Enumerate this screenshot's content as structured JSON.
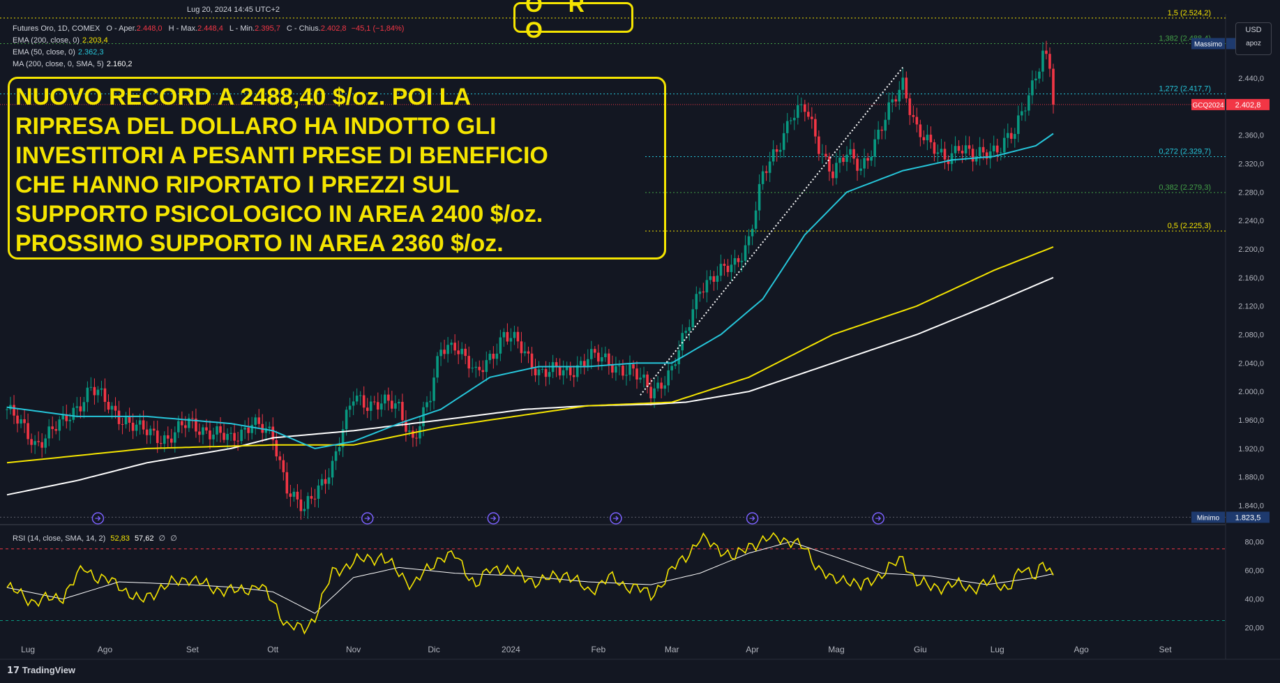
{
  "header": {
    "timestamp": "Lug 20, 2024 14:45 UTC+2",
    "title": "O R O",
    "instrument": "Futures Oro, 1D, COMEX",
    "ohlc": {
      "o_label": "O - Aper.",
      "o": "2.448,0",
      "h_label": "H - Max.",
      "h": "2.448,4",
      "l_label": "L - Min.",
      "l": "2.395,7",
      "c_label": "C - Chius.",
      "c": "2.402,8",
      "chg": "−45,1 (−1,84%)"
    },
    "indicators": [
      {
        "label": "EMA (200, close, 0)",
        "value": "2.203,4",
        "color": "#f5e500"
      },
      {
        "label": "EMA (50, close, 0)",
        "value": "2.362,3",
        "color": "#26c6da"
      },
      {
        "label": "MA (200, close, 0, SMA, 5)",
        "value": "2.160,2",
        "color": "#ffffff"
      }
    ],
    "currency": "USD",
    "currency_sub": "apoz",
    "brand": "TradingView"
  },
  "annotation": {
    "lines": [
      "NUOVO RECORD A 2488,40 $/oz. POI LA",
      "RIPRESA DEL DOLLARO HA INDOTTO GLI",
      "INVESTITORI A PESANTI PRESE DI BENEFICIO",
      "CHE HANNO RIPORTATO I PREZZI SUL",
      "SUPPORTO PSICOLOGICO IN AREA 2400 $/oz.",
      "PROSSIMO SUPPORTO IN AREA 2360 $/oz."
    ]
  },
  "chart_data": [
    {
      "type": "candlestick",
      "ylim": [
        1820,
        2530
      ],
      "y_ticks": [
        1840,
        1880,
        1920,
        1960,
        2000,
        2040,
        2080,
        2120,
        2160,
        2200,
        2240,
        2280,
        2320,
        2360,
        2400,
        2440,
        2480
      ],
      "y_tick_labels": [
        "1.840,0",
        "1.880,0",
        "1.920,0",
        "1.960,0",
        "2.000,0",
        "2.040,0",
        "2.080,0",
        "2.120,0",
        "2.160,0",
        "2.200,0",
        "2.240,0",
        "2.280,0",
        "2.320,0",
        "2.360,0",
        "2.400,0",
        "2.440,0",
        "2.480,0"
      ],
      "x_labels": [
        "Lug",
        "Ago",
        "Set",
        "Ott",
        "Nov",
        "Dic",
        "2024",
        "Feb",
        "Mar",
        "Apr",
        "Mag",
        "Giu",
        "Lug",
        "Ago",
        "Set"
      ],
      "x_label_index": [
        6,
        28,
        53,
        76,
        99,
        122,
        144,
        169,
        190,
        213,
        237,
        261,
        283,
        307,
        331
      ],
      "n_bars": 300,
      "price_path": [
        [
          0,
          1975
        ],
        [
          8,
          1928
        ],
        [
          16,
          1955
        ],
        [
          24,
          2005
        ],
        [
          30,
          1975
        ],
        [
          38,
          1945
        ],
        [
          46,
          1935
        ],
        [
          52,
          1955
        ],
        [
          58,
          1945
        ],
        [
          64,
          1930
        ],
        [
          70,
          1960
        ],
        [
          76,
          1932
        ],
        [
          80,
          1870
        ],
        [
          85,
          1830
        ],
        [
          88,
          1855
        ],
        [
          93,
          1900
        ],
        [
          99,
          1990
        ],
        [
          103,
          1985
        ],
        [
          107,
          1985
        ],
        [
          112,
          1975
        ],
        [
          116,
          1935
        ],
        [
          121,
          1990
        ],
        [
          124,
          2060
        ],
        [
          128,
          2070
        ],
        [
          134,
          2020
        ],
        [
          138,
          2050
        ],
        [
          142,
          2080
        ],
        [
          146,
          2065
        ],
        [
          152,
          2030
        ],
        [
          160,
          2025
        ],
        [
          166,
          2050
        ],
        [
          172,
          2040
        ],
        [
          178,
          2030
        ],
        [
          184,
          2000
        ],
        [
          190,
          2030
        ],
        [
          194,
          2080
        ],
        [
          198,
          2150
        ],
        [
          204,
          2165
        ],
        [
          208,
          2180
        ],
        [
          212,
          2215
        ],
        [
          216,
          2300
        ],
        [
          220,
          2340
        ],
        [
          224,
          2390
        ],
        [
          228,
          2395
        ],
        [
          232,
          2345
        ],
        [
          236,
          2310
        ],
        [
          240,
          2330
        ],
        [
          244,
          2315
        ],
        [
          250,
          2370
        ],
        [
          256,
          2435
        ],
        [
          260,
          2370
        ],
        [
          264,
          2340
        ],
        [
          268,
          2330
        ],
        [
          272,
          2345
        ],
        [
          276,
          2325
        ],
        [
          280,
          2340
        ],
        [
          284,
          2345
        ],
        [
          288,
          2360
        ],
        [
          292,
          2420
        ],
        [
          296,
          2475
        ],
        [
          298,
          2455
        ],
        [
          299,
          2403
        ]
      ],
      "ema200_path": [
        [
          0,
          1900
        ],
        [
          40,
          1920
        ],
        [
          76,
          1925
        ],
        [
          99,
          1925
        ],
        [
          124,
          1950
        ],
        [
          166,
          1980
        ],
        [
          190,
          1985
        ],
        [
          212,
          2020
        ],
        [
          236,
          2080
        ],
        [
          260,
          2120
        ],
        [
          282,
          2170
        ],
        [
          299,
          2203
        ]
      ],
      "ema50_path": [
        [
          0,
          1978
        ],
        [
          20,
          1965
        ],
        [
          40,
          1965
        ],
        [
          64,
          1955
        ],
        [
          76,
          1945
        ],
        [
          88,
          1920
        ],
        [
          99,
          1930
        ],
        [
          112,
          1955
        ],
        [
          124,
          1975
        ],
        [
          138,
          2020
        ],
        [
          152,
          2035
        ],
        [
          166,
          2035
        ],
        [
          180,
          2040
        ],
        [
          190,
          2040
        ],
        [
          204,
          2080
        ],
        [
          216,
          2130
        ],
        [
          228,
          2220
        ],
        [
          240,
          2280
        ],
        [
          256,
          2310
        ],
        [
          270,
          2325
        ],
        [
          282,
          2330
        ],
        [
          294,
          2345
        ],
        [
          299,
          2362
        ]
      ],
      "ma200_path": [
        [
          0,
          1855
        ],
        [
          20,
          1875
        ],
        [
          40,
          1900
        ],
        [
          64,
          1920
        ],
        [
          76,
          1935
        ],
        [
          99,
          1945
        ],
        [
          124,
          1960
        ],
        [
          148,
          1975
        ],
        [
          166,
          1980
        ],
        [
          184,
          1982
        ],
        [
          194,
          1985
        ],
        [
          212,
          2000
        ],
        [
          236,
          2040
        ],
        [
          260,
          2080
        ],
        [
          280,
          2120
        ],
        [
          299,
          2160
        ]
      ],
      "fib_levels": [
        {
          "value": 2524.2,
          "label": "1,5 (2.524,2)",
          "color": "#f5e500",
          "style": "dotted"
        },
        {
          "value": 2488.4,
          "label": "1,382 (2.488,4)",
          "color": "#43a047",
          "style": "dotted"
        },
        {
          "value": 2417.7,
          "label": "1,272 (2.417,7)",
          "color": "#26c6da",
          "style": "dotted"
        },
        {
          "value": 2329.7,
          "label": "0,272 (2.329,7)",
          "color": "#26c6da",
          "style": "dotted"
        },
        {
          "value": 2279.3,
          "label": "0,382 (2.279,3)",
          "color": "#43a047",
          "style": "dotted"
        },
        {
          "value": 2225.3,
          "label": "0,5 (2.225,3)",
          "color": "#f5e500",
          "style": "dotted"
        }
      ],
      "trend_line": {
        "from": [
          181,
          1995
        ],
        "to": [
          256,
          2455
        ]
      },
      "price_tags": [
        {
          "label": "Massimo",
          "value": "2.488,4",
          "price": 2488.4
        },
        {
          "label": "GCQ2024",
          "value": "2.402,8",
          "price": 2402.8
        },
        {
          "label": "Minimo",
          "value": "1.823,5",
          "price": 1823.5
        }
      ],
      "event_markers": [
        26,
        103,
        139,
        174,
        213,
        249
      ]
    },
    {
      "type": "line",
      "title": "RSI (14, close, SMA, 14, 2)",
      "values_label": [
        "52,83",
        "57,62",
        "∅",
        "∅"
      ],
      "ylim": [
        15,
        88
      ],
      "y_ticks": [
        20,
        40,
        60,
        80
      ],
      "y_tick_labels": [
        "20,00",
        "40,00",
        "60,00",
        "80,00"
      ],
      "bands": [
        75,
        25
      ],
      "rsi_path": [
        [
          0,
          48
        ],
        [
          8,
          38
        ],
        [
          16,
          42
        ],
        [
          22,
          62
        ],
        [
          26,
          55
        ],
        [
          32,
          50
        ],
        [
          38,
          38
        ],
        [
          44,
          48
        ],
        [
          52,
          55
        ],
        [
          58,
          48
        ],
        [
          66,
          45
        ],
        [
          72,
          50
        ],
        [
          76,
          38
        ],
        [
          80,
          22
        ],
        [
          85,
          18
        ],
        [
          88,
          28
        ],
        [
          93,
          58
        ],
        [
          99,
          66
        ],
        [
          103,
          68
        ],
        [
          107,
          70
        ],
        [
          112,
          58
        ],
        [
          116,
          50
        ],
        [
          121,
          62
        ],
        [
          124,
          70
        ],
        [
          128,
          70
        ],
        [
          134,
          50
        ],
        [
          138,
          60
        ],
        [
          142,
          62
        ],
        [
          148,
          55
        ],
        [
          152,
          52
        ],
        [
          160,
          58
        ],
        [
          166,
          45
        ],
        [
          172,
          55
        ],
        [
          176,
          50
        ],
        [
          180,
          48
        ],
        [
          184,
          42
        ],
        [
          190,
          60
        ],
        [
          194,
          70
        ],
        [
          198,
          82
        ],
        [
          204,
          75
        ],
        [
          208,
          68
        ],
        [
          212,
          78
        ],
        [
          216,
          80
        ],
        [
          220,
          84
        ],
        [
          224,
          80
        ],
        [
          228,
          75
        ],
        [
          232,
          62
        ],
        [
          236,
          52
        ],
        [
          240,
          55
        ],
        [
          244,
          48
        ],
        [
          250,
          58
        ],
        [
          256,
          68
        ],
        [
          260,
          52
        ],
        [
          264,
          48
        ],
        [
          270,
          50
        ],
        [
          276,
          48
        ],
        [
          282,
          52
        ],
        [
          286,
          48
        ],
        [
          290,
          60
        ],
        [
          294,
          58
        ],
        [
          296,
          66
        ],
        [
          299,
          53
        ]
      ],
      "sma_path": [
        [
          0,
          48
        ],
        [
          16,
          40
        ],
        [
          32,
          52
        ],
        [
          52,
          50
        ],
        [
          66,
          48
        ],
        [
          76,
          45
        ],
        [
          88,
          30
        ],
        [
          99,
          55
        ],
        [
          112,
          62
        ],
        [
          128,
          58
        ],
        [
          148,
          56
        ],
        [
          166,
          52
        ],
        [
          184,
          50
        ],
        [
          198,
          58
        ],
        [
          212,
          72
        ],
        [
          224,
          80
        ],
        [
          236,
          70
        ],
        [
          250,
          58
        ],
        [
          264,
          56
        ],
        [
          280,
          50
        ],
        [
          294,
          55
        ],
        [
          299,
          57.6
        ]
      ]
    }
  ]
}
